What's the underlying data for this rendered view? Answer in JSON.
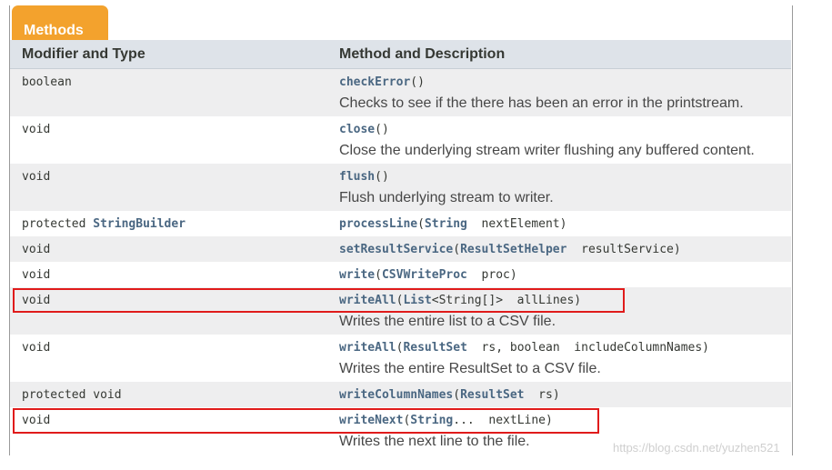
{
  "tab": {
    "label": "Methods"
  },
  "header": {
    "col1": "Modifier and Type",
    "col2": "Method and Description"
  },
  "rows": [
    {
      "modifier": "boolean",
      "name": "checkError",
      "params": "()",
      "desc": "Checks to see if the there has been an error in the printstream."
    },
    {
      "modifier": "void",
      "name": "close",
      "params": "()",
      "desc": "Close the underlying stream writer flushing any buffered content."
    },
    {
      "modifier": "void",
      "name": "flush",
      "params": "()",
      "desc": "Flush underlying stream to writer."
    },
    {
      "modifier_prefix": "protected ",
      "modifier_type": "StringBuilder",
      "name": "processLine",
      "p_open": "(",
      "p_type": "String",
      "p_rest": "  nextElement)"
    },
    {
      "modifier": "void",
      "name": "setResultService",
      "p_open": "(",
      "p_type": "ResultSetHelper",
      "p_rest": "  resultService)"
    },
    {
      "modifier": "void",
      "name": "write",
      "p_open": "(",
      "p_type": "CSVWriteProc",
      "p_rest": "  proc)"
    },
    {
      "modifier": "void",
      "name": "writeAll",
      "p_open": "(",
      "p_type": "List",
      "p_rest": "<String[]>  allLines)",
      "desc": "Writes the entire list to a CSV file."
    },
    {
      "modifier": "void",
      "name": "writeAll",
      "p_open": "(",
      "p_type": "ResultSet",
      "p_rest": "  rs, boolean  includeColumnNames)",
      "desc": "Writes the entire ResultSet to a CSV file."
    },
    {
      "modifier": "protected void",
      "name": "writeColumnNames",
      "p_open": "(",
      "p_type": "ResultSet",
      "p_rest": "  rs)"
    },
    {
      "modifier": "void",
      "name": "writeNext",
      "p_open": "(",
      "p_type": "String",
      "p_rest": "...  nextLine)",
      "desc": "Writes the next line to the file."
    }
  ],
  "watermark": "https://blog.csdn.net/yuzhen521",
  "colors": {
    "tab": "#f3a22d",
    "header": "#dee3e9",
    "link": "#4a6782",
    "highlight": "#e01b1b"
  }
}
